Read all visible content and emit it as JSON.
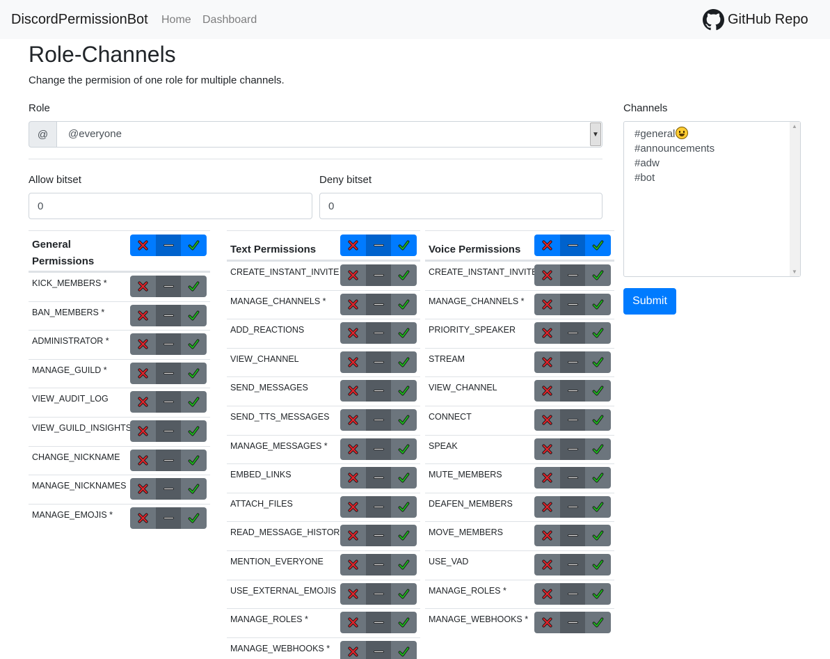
{
  "navbar": {
    "brand": "DiscordPermissionBot",
    "links": [
      "Home",
      "Dashboard"
    ],
    "github_label": "GitHub Repo"
  },
  "header": {
    "title": "Role-Channels",
    "lead": "Change the permision of one role for multiple channels."
  },
  "form": {
    "role_label": "Role",
    "role_prefix": "@",
    "role_value": "@everyone",
    "allow_label": "Allow bitset",
    "allow_value": "0",
    "deny_label": "Deny bitset",
    "deny_value": "0",
    "channels_label": "Channels",
    "channels": [
      "#general",
      "#announcements",
      "#adw",
      "#bot"
    ],
    "submit_label": "Submit"
  },
  "permissions": {
    "general": {
      "title": "General Permissions",
      "items": [
        "KICK_MEMBERS *",
        "BAN_MEMBERS *",
        "ADMINISTRATOR *",
        "MANAGE_GUILD *",
        "VIEW_AUDIT_LOG",
        "VIEW_GUILD_INSIGHTS",
        "CHANGE_NICKNAME",
        "MANAGE_NICKNAMES",
        "MANAGE_EMOJIS *"
      ]
    },
    "text": {
      "title": "Text Permissions",
      "items": [
        "CREATE_INSTANT_INVITE",
        "MANAGE_CHANNELS *",
        "ADD_REACTIONS",
        "VIEW_CHANNEL",
        "SEND_MESSAGES",
        "SEND_TTS_MESSAGES",
        "MANAGE_MESSAGES *",
        "EMBED_LINKS",
        "ATTACH_FILES",
        "READ_MESSAGE_HISTORY",
        "MENTION_EVERYONE",
        "USE_EXTERNAL_EMOJIS",
        "MANAGE_ROLES *",
        "MANAGE_WEBHOOKS *"
      ]
    },
    "voice": {
      "title": "Voice Permissions",
      "items": [
        "CREATE_INSTANT_INVITE",
        "MANAGE_CHANNELS *",
        "PRIORITY_SPEAKER",
        "STREAM",
        "VIEW_CHANNEL",
        "CONNECT",
        "SPEAK",
        "MUTE_MEMBERS",
        "DEAFEN_MEMBERS",
        "MOVE_MEMBERS",
        "USE_VAD",
        "MANAGE_ROLES *",
        "MANAGE_WEBHOOKS *"
      ]
    }
  },
  "icons": {
    "deny": "red-x-icon",
    "neutral": "dash-icon",
    "allow": "green-check-icon"
  },
  "colors": {
    "primary": "#007bff",
    "secondary": "#6c757d",
    "deny": "#e0242b",
    "allow": "#1fb51f"
  }
}
